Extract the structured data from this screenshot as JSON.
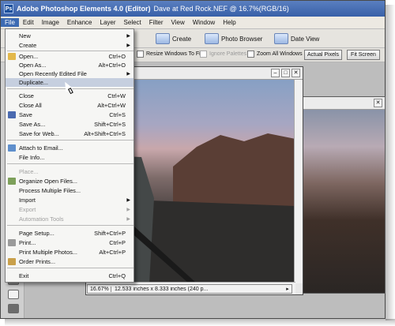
{
  "window": {
    "app_title": "Adobe Photoshop Elements 4.0 (Editor)",
    "document_title": "Dave at Red Rock.NEF @ 16.7%(RGB/16)"
  },
  "menubar": [
    "File",
    "Edit",
    "Image",
    "Enhance",
    "Layer",
    "Select",
    "Filter",
    "View",
    "Window",
    "Help"
  ],
  "toolbar": {
    "create_label": "Create",
    "photo_browser_label": "Photo Browser",
    "date_view_label": "Date View"
  },
  "options_bar": {
    "resize_windows": "Resize Windows To Fit",
    "ignore_palettes": "Ignore Palettes",
    "zoom_all": "Zoom All Windows",
    "actual_pixels": "Actual Pixels",
    "fit_screen": "Fit Screen"
  },
  "file_menu": [
    {
      "label": "New",
      "shortcut": "",
      "submenu": true
    },
    {
      "label": "Create",
      "shortcut": "",
      "submenu": true
    },
    {
      "label": "Open...",
      "shortcut": "Ctrl+O"
    },
    {
      "label": "Open As...",
      "shortcut": "Alt+Ctrl+O"
    },
    {
      "label": "Open Recently Edited File",
      "shortcut": "",
      "submenu": true
    },
    {
      "label": "Duplicate...",
      "shortcut": ""
    },
    {
      "label": "Close",
      "shortcut": "Ctrl+W"
    },
    {
      "label": "Close All",
      "shortcut": "Alt+Ctrl+W"
    },
    {
      "label": "Save",
      "shortcut": "Ctrl+S"
    },
    {
      "label": "Save As...",
      "shortcut": "Shift+Ctrl+S"
    },
    {
      "label": "Save for Web...",
      "shortcut": "Alt+Shift+Ctrl+S"
    },
    {
      "label": "Attach to Email...",
      "shortcut": ""
    },
    {
      "label": "File Info...",
      "shortcut": ""
    },
    {
      "label": "Place...",
      "shortcut": ""
    },
    {
      "label": "Organize Open Files...",
      "shortcut": ""
    },
    {
      "label": "Process Multiple Files...",
      "shortcut": ""
    },
    {
      "label": "Import",
      "shortcut": "",
      "submenu": true
    },
    {
      "label": "Export",
      "shortcut": "",
      "submenu": true
    },
    {
      "label": "Automation Tools",
      "shortcut": "",
      "submenu": true
    },
    {
      "label": "Page Setup...",
      "shortcut": "Shift+Ctrl+P"
    },
    {
      "label": "Print...",
      "shortcut": "Ctrl+P"
    },
    {
      "label": "Print Multiple Photos...",
      "shortcut": "Alt+Ctrl+P"
    },
    {
      "label": "Order Prints...",
      "shortcut": ""
    },
    {
      "label": "Exit",
      "shortcut": "Ctrl+Q"
    }
  ],
  "document": {
    "title_fragment": "/16)",
    "zoom": "16.67%",
    "status_info": "12.533 inches x 8.333 inches (240 p..."
  },
  "colors": {
    "menu_highlight": "#c6cfdf",
    "titlebar": "#3860a8",
    "menubar_active": "#3d6bb3"
  }
}
